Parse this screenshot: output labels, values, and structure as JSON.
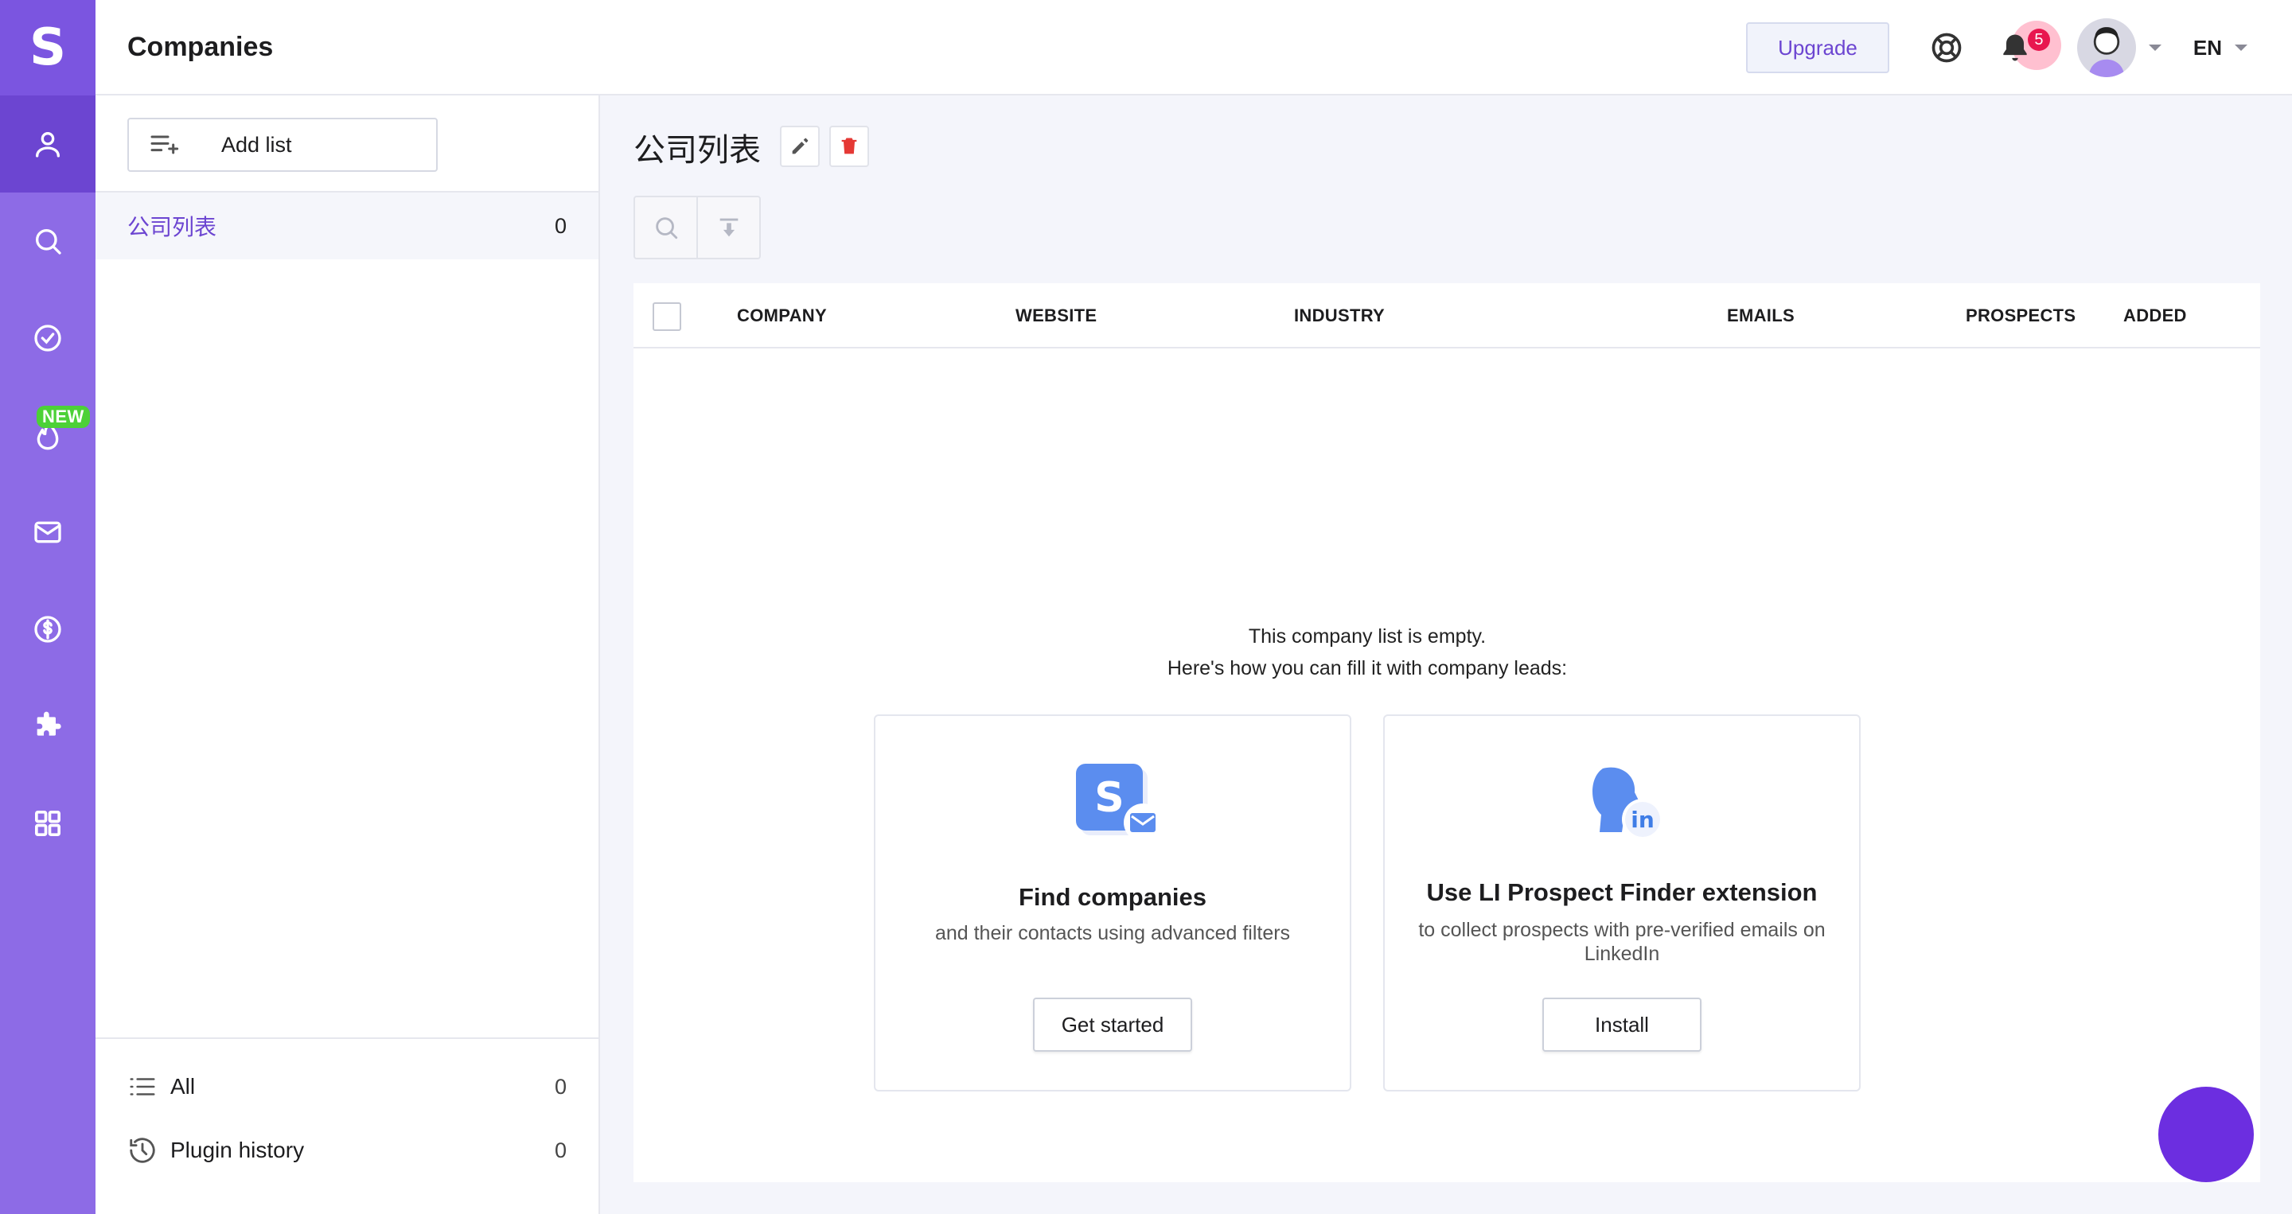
{
  "rail": {
    "logo": "S",
    "new_badge": "NEW",
    "colors": {
      "rail": "#8d6be6",
      "active": "#6c45d1"
    },
    "items": [
      {
        "icon": "user-icon"
      },
      {
        "icon": "search-icon"
      },
      {
        "icon": "check-circle-icon"
      },
      {
        "icon": "fire-icon"
      },
      {
        "icon": "mail-icon"
      },
      {
        "icon": "dollar-icon"
      },
      {
        "icon": "puzzle-icon"
      },
      {
        "icon": "apps-icon"
      }
    ]
  },
  "header": {
    "title": "Companies",
    "upgrade_label": "Upgrade",
    "notification_count": "5",
    "language": "EN"
  },
  "lists": {
    "add_label": "Add list",
    "selected": {
      "name": "公司列表",
      "count": "0"
    },
    "bottom": [
      {
        "name": "All",
        "count": "0"
      },
      {
        "name": "Plugin history",
        "count": "0"
      }
    ]
  },
  "main": {
    "list_title": "公司列表",
    "columns": [
      "COMPANY",
      "WEBSITE",
      "INDUSTRY",
      "EMAILS",
      "PROSPECTS",
      "ADDED"
    ],
    "empty_line1": "This company list is empty.",
    "empty_line2": "Here's how you can fill it with company leads:",
    "cards": [
      {
        "title": "Find companies",
        "subtitle": "and their contacts using advanced filters",
        "button": "Get started",
        "logo": "S"
      },
      {
        "title": "Use LI Prospect Finder extension",
        "subtitle": "to collect prospects with pre-verified emails on LinkedIn",
        "button": "Install",
        "logo": "in"
      }
    ]
  }
}
